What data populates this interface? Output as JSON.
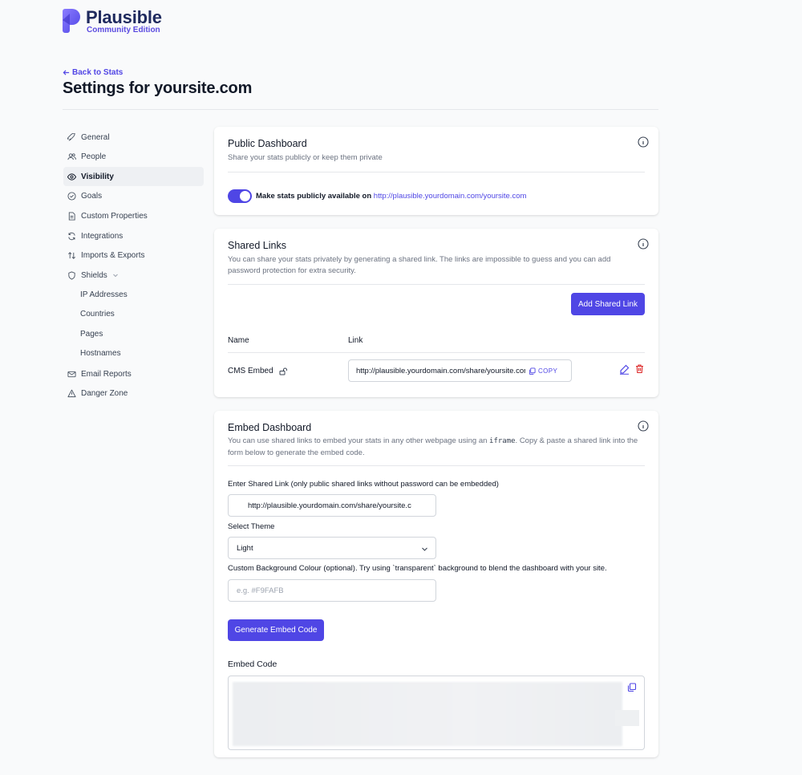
{
  "brand": {
    "name": "Plausible",
    "edition": "Community Edition",
    "accent": "#4f46e5"
  },
  "header": {
    "back_label": "Back to Stats",
    "page_title": "Settings for yoursite.com"
  },
  "sidebar": {
    "items": [
      {
        "label": "General",
        "icon": "rocket-icon"
      },
      {
        "label": "People",
        "icon": "users-icon"
      },
      {
        "label": "Visibility",
        "icon": "eye-icon",
        "active": true
      },
      {
        "label": "Goals",
        "icon": "check-circle-icon"
      },
      {
        "label": "Custom Properties",
        "icon": "document-icon"
      },
      {
        "label": "Integrations",
        "icon": "refresh-icon"
      },
      {
        "label": "Imports & Exports",
        "icon": "arrows-up-down-icon"
      },
      {
        "label": "Shields",
        "icon": "shield-icon"
      },
      {
        "label": "Email Reports",
        "icon": "envelope-icon"
      },
      {
        "label": "Danger Zone",
        "icon": "warning-icon"
      }
    ],
    "shields_sub": [
      "IP Addresses",
      "Countries",
      "Pages",
      "Hostnames"
    ]
  },
  "public_dashboard": {
    "title": "Public Dashboard",
    "description": "Share your stats publicly or keep them private",
    "toggle_on": true,
    "toggle_label": "Make stats publicly available on",
    "toggle_link": "http://plausible.yourdomain.com/yoursite.com"
  },
  "shared_links": {
    "title": "Shared Links",
    "description": "You can share your stats privately by generating a shared link. The links are impossible to guess and you can add password protection for extra security.",
    "add_button": "Add Shared Link",
    "columns": [
      "Name",
      "Link"
    ],
    "rows": [
      {
        "name": "CMS Embed",
        "link": "http://plausible.yourdomain.com/share/yoursite.com?auth=",
        "copy_label": "COPY"
      }
    ]
  },
  "embed_dashboard": {
    "title": "Embed Dashboard",
    "description_pre": "You can use shared links to embed your stats in any other webpage using an",
    "description_code": "iframe",
    "description_post": ". Copy & paste a shared link into the form below to generate the embed code.",
    "shared_link_label": "Enter Shared Link (only public shared links without password can be embedded)",
    "shared_link_value": "http://plausible.yourdomain.com/share/yoursite.c",
    "theme_label": "Select Theme",
    "theme_value": "Light",
    "bg_label": "Custom Background Colour (optional). Try using `transparent` background to blend the dashboard with your site.",
    "bg_placeholder": "e.g. #F9FAFB",
    "generate_button": "Generate Embed Code",
    "code_label": "Embed Code"
  }
}
